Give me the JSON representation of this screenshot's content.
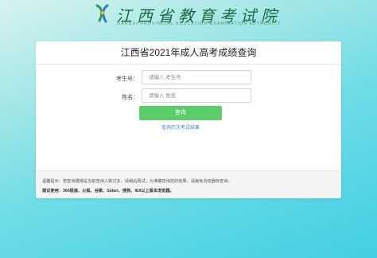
{
  "header": {
    "logo_text": "江西省教育考试院",
    "logo_subtitle": "JIANGXI PROVINCIAL EDUCATION EXAMINATION AUTHORITY",
    "brand_color": "#1b6b43"
  },
  "card": {
    "title": "江西省2021年成人高考成绩查询",
    "exam_no_label": "考生号：",
    "exam_no_placeholder": "请输入 考生号",
    "name_label": "姓名：",
    "name_placeholder": "请输入 姓名",
    "query_button": "查询",
    "history_link": "查询历次考试结果",
    "button_color": "#5ccd6a"
  },
  "notice": {
    "tip_label": "温馨提示：",
    "tip_text": "若查询遇慢是当前查询人数过多，请稍后再试；为准确查询您的结果，请避免浏览器存查询。",
    "browser_label": "建议使用：",
    "browser_text": "360极速、火狐、谷歌、Safari、搜狗、IE9以上版本浏览器。"
  }
}
